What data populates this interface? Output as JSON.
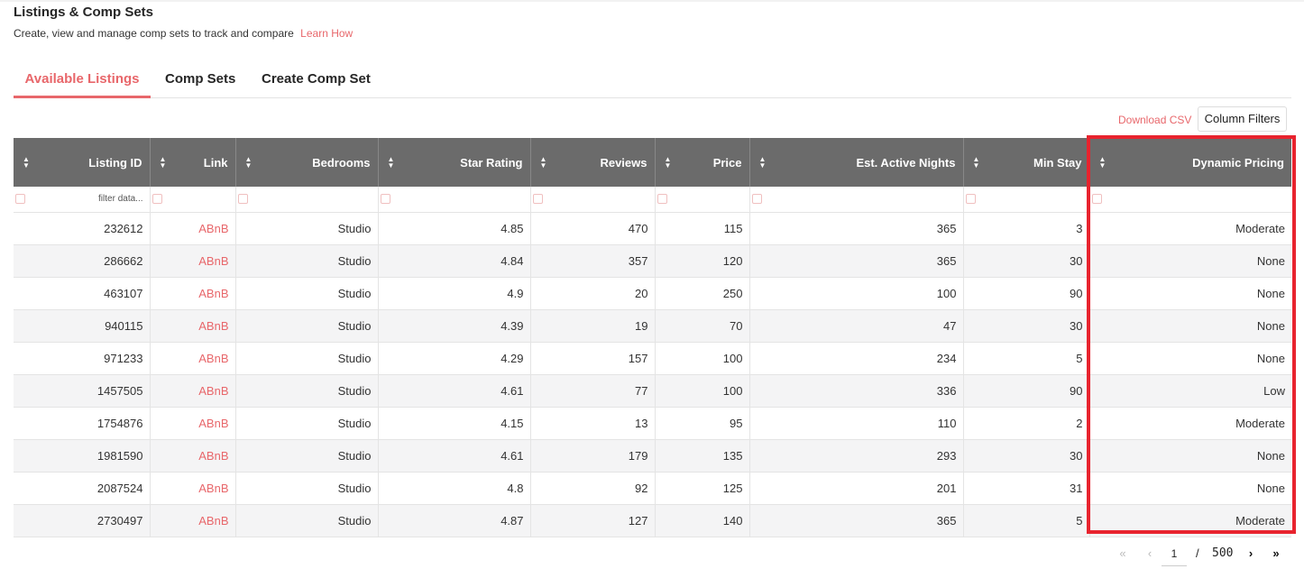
{
  "header": {
    "title": "Listings & Comp Sets",
    "subtitle": "Create, view and manage comp sets to track and compare",
    "learn_link": "Learn How"
  },
  "tabs": [
    {
      "label": "Available Listings",
      "active": true
    },
    {
      "label": "Comp Sets",
      "active": false
    },
    {
      "label": "Create Comp Set",
      "active": false
    }
  ],
  "toolbar": {
    "download_label": "Download CSV",
    "column_filters_label": "Column Filters"
  },
  "table": {
    "columns": [
      "Listing ID",
      "Link",
      "Bedrooms",
      "Star Rating",
      "Reviews",
      "Price",
      "Est. Active Nights",
      "Min Stay",
      "Dynamic Pricing"
    ],
    "filter_placeholder": "filter data...",
    "rows": [
      [
        "232612",
        "ABnB",
        "Studio",
        "4.85",
        "470",
        "115",
        "365",
        "3",
        "Moderate"
      ],
      [
        "286662",
        "ABnB",
        "Studio",
        "4.84",
        "357",
        "120",
        "365",
        "30",
        "None"
      ],
      [
        "463107",
        "ABnB",
        "Studio",
        "4.9",
        "20",
        "250",
        "100",
        "90",
        "None"
      ],
      [
        "940115",
        "ABnB",
        "Studio",
        "4.39",
        "19",
        "70",
        "47",
        "30",
        "None"
      ],
      [
        "971233",
        "ABnB",
        "Studio",
        "4.29",
        "157",
        "100",
        "234",
        "5",
        "None"
      ],
      [
        "1457505",
        "ABnB",
        "Studio",
        "4.61",
        "77",
        "100",
        "336",
        "90",
        "Low"
      ],
      [
        "1754876",
        "ABnB",
        "Studio",
        "4.15",
        "13",
        "95",
        "110",
        "2",
        "Moderate"
      ],
      [
        "1981590",
        "ABnB",
        "Studio",
        "4.61",
        "179",
        "135",
        "293",
        "30",
        "None"
      ],
      [
        "2087524",
        "ABnB",
        "Studio",
        "4.8",
        "92",
        "125",
        "201",
        "31",
        "None"
      ],
      [
        "2730497",
        "ABnB",
        "Studio",
        "4.87",
        "127",
        "140",
        "365",
        "5",
        "Moderate"
      ]
    ]
  },
  "pagination": {
    "current_page": "1",
    "separator": "/",
    "total_pages": "500"
  },
  "colors": {
    "accent": "#e8676b",
    "header_bg": "#6b6b6b",
    "highlight": "#e8232e"
  }
}
